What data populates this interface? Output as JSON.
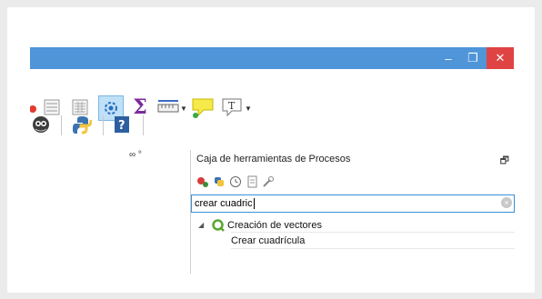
{
  "window": {
    "minimize_label": "–",
    "maximize_label": "❐",
    "close_label": "✕"
  },
  "toolbar_icons": [
    "attribute-table-icon",
    "field-calculator-icon",
    "processing-gear-icon",
    "sum-icon",
    "measure-icon",
    "annotation-icon",
    "text-annotation-icon"
  ],
  "secondary_toolbar_icons": [
    "plugins-icon",
    "python-console-icon",
    "help-icon"
  ],
  "toolbox": {
    "title": "Caja de herramientas de Procesos",
    "float_label": "🗗",
    "search_value": "crear cuadric",
    "tree": {
      "group_label": "Creación de vectores",
      "item_label": "Crear cuadrícula"
    }
  },
  "colors": {
    "titlebar": "#4f95d8",
    "close_button": "#e04343",
    "search_border": "#3b8fd6"
  }
}
